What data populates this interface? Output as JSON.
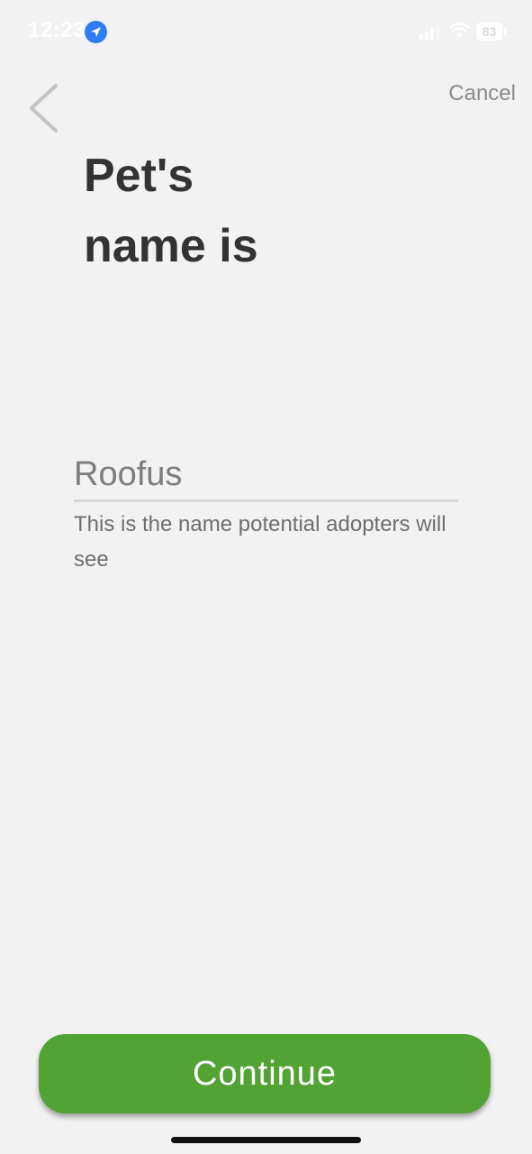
{
  "status_bar": {
    "time": "12:23",
    "battery": "83"
  },
  "nav": {
    "cancel_label": "Cancel"
  },
  "main": {
    "title_line1": "Pet's",
    "title_line2": "name is",
    "name_input": {
      "value": "",
      "placeholder": "Roofus"
    },
    "helper_text": "This is the name potential adopters will see"
  },
  "footer": {
    "continue_label": "Continue"
  },
  "colors": {
    "background": "#f2f2f2",
    "accent_green": "#51a333",
    "title_text": "#333333",
    "muted_text": "#8a8a8a",
    "location_blue": "#2f7cf6"
  },
  "icons": {
    "back": "chevron-left-icon",
    "location": "location-arrow-icon",
    "signal": "cellular-signal-icon",
    "wifi": "wifi-icon",
    "battery": "battery-icon"
  }
}
